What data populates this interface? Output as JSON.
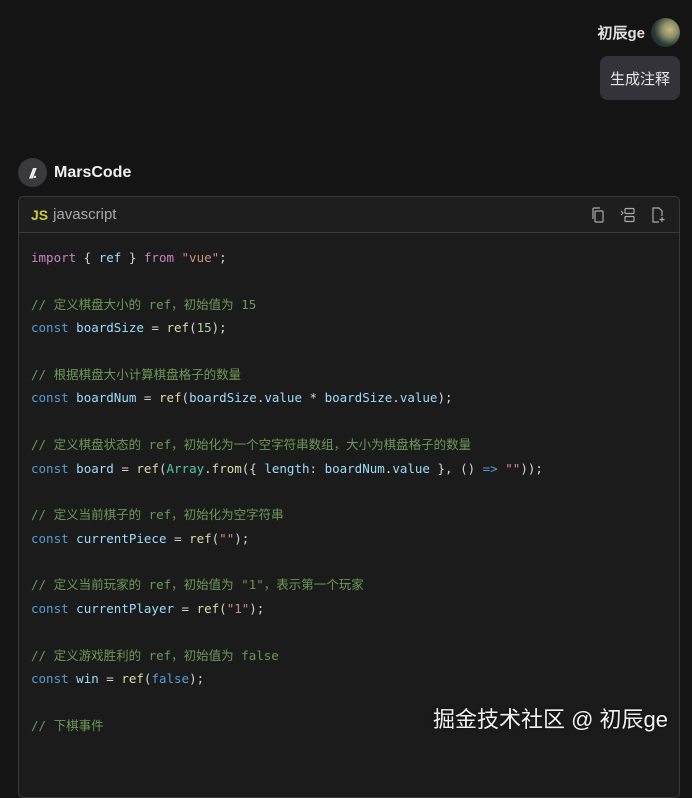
{
  "user": {
    "name": "初辰ge",
    "message": "生成注释"
  },
  "bot": {
    "name": "MarsCode"
  },
  "code_block": {
    "badge": "JS",
    "language": "javascript",
    "tools": [
      "copy-icon",
      "insert-icon",
      "new-file-icon"
    ],
    "lines": [
      [
        [
          "kw",
          "import"
        ],
        [
          "pn",
          " { "
        ],
        [
          "var",
          "ref"
        ],
        [
          "pn",
          " } "
        ],
        [
          "kw",
          "from"
        ],
        [
          "pn",
          " "
        ],
        [
          "str",
          "\"vue\""
        ],
        [
          "pn",
          ";"
        ]
      ],
      [],
      [
        [
          "cm",
          "// 定义棋盘大小的 ref，初始值为 15"
        ]
      ],
      [
        [
          "st",
          "const"
        ],
        [
          "pn",
          " "
        ],
        [
          "var",
          "boardSize"
        ],
        [
          "pn",
          " = "
        ],
        [
          "fn",
          "ref"
        ],
        [
          "pn",
          "("
        ],
        [
          "num",
          "15"
        ],
        [
          "pn",
          ");"
        ]
      ],
      [],
      [
        [
          "cm",
          "// 根据棋盘大小计算棋盘格子的数量"
        ]
      ],
      [
        [
          "st",
          "const"
        ],
        [
          "pn",
          " "
        ],
        [
          "var",
          "boardNum"
        ],
        [
          "pn",
          " = "
        ],
        [
          "fn",
          "ref"
        ],
        [
          "pn",
          "("
        ],
        [
          "var",
          "boardSize"
        ],
        [
          "pn",
          "."
        ],
        [
          "var",
          "value"
        ],
        [
          "pn",
          " * "
        ],
        [
          "var",
          "boardSize"
        ],
        [
          "pn",
          "."
        ],
        [
          "var",
          "value"
        ],
        [
          "pn",
          ");"
        ]
      ],
      [],
      [
        [
          "cm",
          "// 定义棋盘状态的 ref，初始化为一个空字符串数组，大小为棋盘格子的数量"
        ]
      ],
      [
        [
          "st",
          "const"
        ],
        [
          "pn",
          " "
        ],
        [
          "var",
          "board"
        ],
        [
          "pn",
          " = "
        ],
        [
          "fn",
          "ref"
        ],
        [
          "pn",
          "("
        ],
        [
          "cls",
          "Array"
        ],
        [
          "pn",
          "."
        ],
        [
          "fn",
          "from"
        ],
        [
          "pn",
          "({ "
        ],
        [
          "var",
          "length"
        ],
        [
          "pn",
          ": "
        ],
        [
          "var",
          "boardNum"
        ],
        [
          "pn",
          "."
        ],
        [
          "var",
          "value"
        ],
        [
          "pn",
          " }, () "
        ],
        [
          "st",
          "=>"
        ],
        [
          "pn",
          " "
        ],
        [
          "str",
          "\"\""
        ],
        [
          "pn",
          "));"
        ]
      ],
      [],
      [
        [
          "cm",
          "// 定义当前棋子的 ref，初始化为空字符串"
        ]
      ],
      [
        [
          "st",
          "const"
        ],
        [
          "pn",
          " "
        ],
        [
          "var",
          "currentPiece"
        ],
        [
          "pn",
          " = "
        ],
        [
          "fn",
          "ref"
        ],
        [
          "pn",
          "("
        ],
        [
          "str",
          "\"\""
        ],
        [
          "pn",
          ");"
        ]
      ],
      [],
      [
        [
          "cm",
          "// 定义当前玩家的 ref，初始值为 \"1\"，表示第一个玩家"
        ]
      ],
      [
        [
          "st",
          "const"
        ],
        [
          "pn",
          " "
        ],
        [
          "var",
          "currentPlayer"
        ],
        [
          "pn",
          " = "
        ],
        [
          "fn",
          "ref"
        ],
        [
          "pn",
          "("
        ],
        [
          "str",
          "\"1\""
        ],
        [
          "pn",
          ");"
        ]
      ],
      [],
      [
        [
          "cm",
          "// 定义游戏胜利的 ref，初始值为 false"
        ]
      ],
      [
        [
          "st",
          "const"
        ],
        [
          "pn",
          " "
        ],
        [
          "var",
          "win"
        ],
        [
          "pn",
          " = "
        ],
        [
          "fn",
          "ref"
        ],
        [
          "pn",
          "("
        ],
        [
          "st",
          "false"
        ],
        [
          "pn",
          ");"
        ]
      ],
      [],
      [
        [
          "cm",
          "// 下棋事件"
        ]
      ]
    ]
  },
  "watermark": "掘金技术社区 @ 初辰ge"
}
